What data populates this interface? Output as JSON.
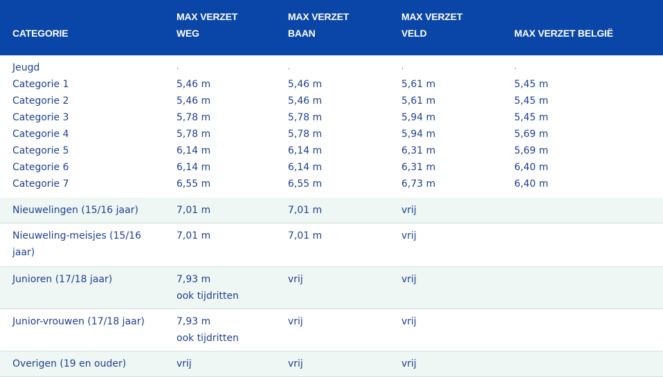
{
  "headers": {
    "categorie": "CATEGORIE",
    "weg_line1": "MAX VERZET",
    "weg_line2": "WEG",
    "baan_line1": "MAX VERZET",
    "baan_line2": "BAAN",
    "veld_line1": "MAX VERZET",
    "veld_line2": "VELD",
    "belgie": "MAX VERZET BELGIË"
  },
  "jeugd": {
    "label": "Jeugd",
    "placeholders": [
      ".",
      ".",
      ".",
      "."
    ],
    "rows": [
      {
        "cat": "Categorie 1",
        "weg": "5,46 m",
        "baan": "5,46 m",
        "veld": "5,61 m",
        "belgie": "5,45 m"
      },
      {
        "cat": "Categorie 2",
        "weg": "5,46 m",
        "baan": "5,46 m",
        "veld": "5,61 m",
        "belgie": "5,45 m"
      },
      {
        "cat": "Categorie 3",
        "weg": "5,78 m",
        "baan": "5,78 m",
        "veld": "5,94 m",
        "belgie": "5,45 m"
      },
      {
        "cat": "Categorie 4",
        "weg": "5,78 m",
        "baan": "5,78 m",
        "veld": "5,94 m",
        "belgie": "5,69 m"
      },
      {
        "cat": "Categorie 5",
        "weg": "6,14 m",
        "baan": "6,14 m",
        "veld": "6,31 m",
        "belgie": "5,69 m"
      },
      {
        "cat": "Categorie 6",
        "weg": "6,14 m",
        "baan": "6,14 m",
        "veld": "6,31 m",
        "belgie": "6,40 m"
      },
      {
        "cat": "Categorie 7",
        "weg": "6,55 m",
        "baan": "6,55 m",
        "veld": "6,73 m",
        "belgie": "6,40 m"
      }
    ]
  },
  "rows": [
    {
      "cat": "Nieuwelingen (15/16 jaar)",
      "weg": "7,01 m",
      "weg2": "",
      "baan": "7,01 m",
      "veld": "vrij",
      "belgie": ""
    },
    {
      "cat": "Nieuweling-meisjes (15/16 jaar)",
      "weg": "7,01 m",
      "weg2": "",
      "baan": "7,01 m",
      "veld": "vrij",
      "belgie": ""
    },
    {
      "cat": "Junioren (17/18 jaar)",
      "weg": "7,93 m",
      "weg2": "ook tijdritten",
      "baan": "vrij",
      "veld": "vrij",
      "belgie": ""
    },
    {
      "cat": "Junior-vrouwen (17/18 jaar)",
      "weg": "7,93 m",
      "weg2": "ook tijdritten",
      "baan": "vrij",
      "veld": "vrij",
      "belgie": ""
    },
    {
      "cat": "Overigen (19 en ouder)",
      "weg": "vrij",
      "weg2": "",
      "baan": "vrij",
      "veld": "vrij",
      "belgie": ""
    }
  ]
}
